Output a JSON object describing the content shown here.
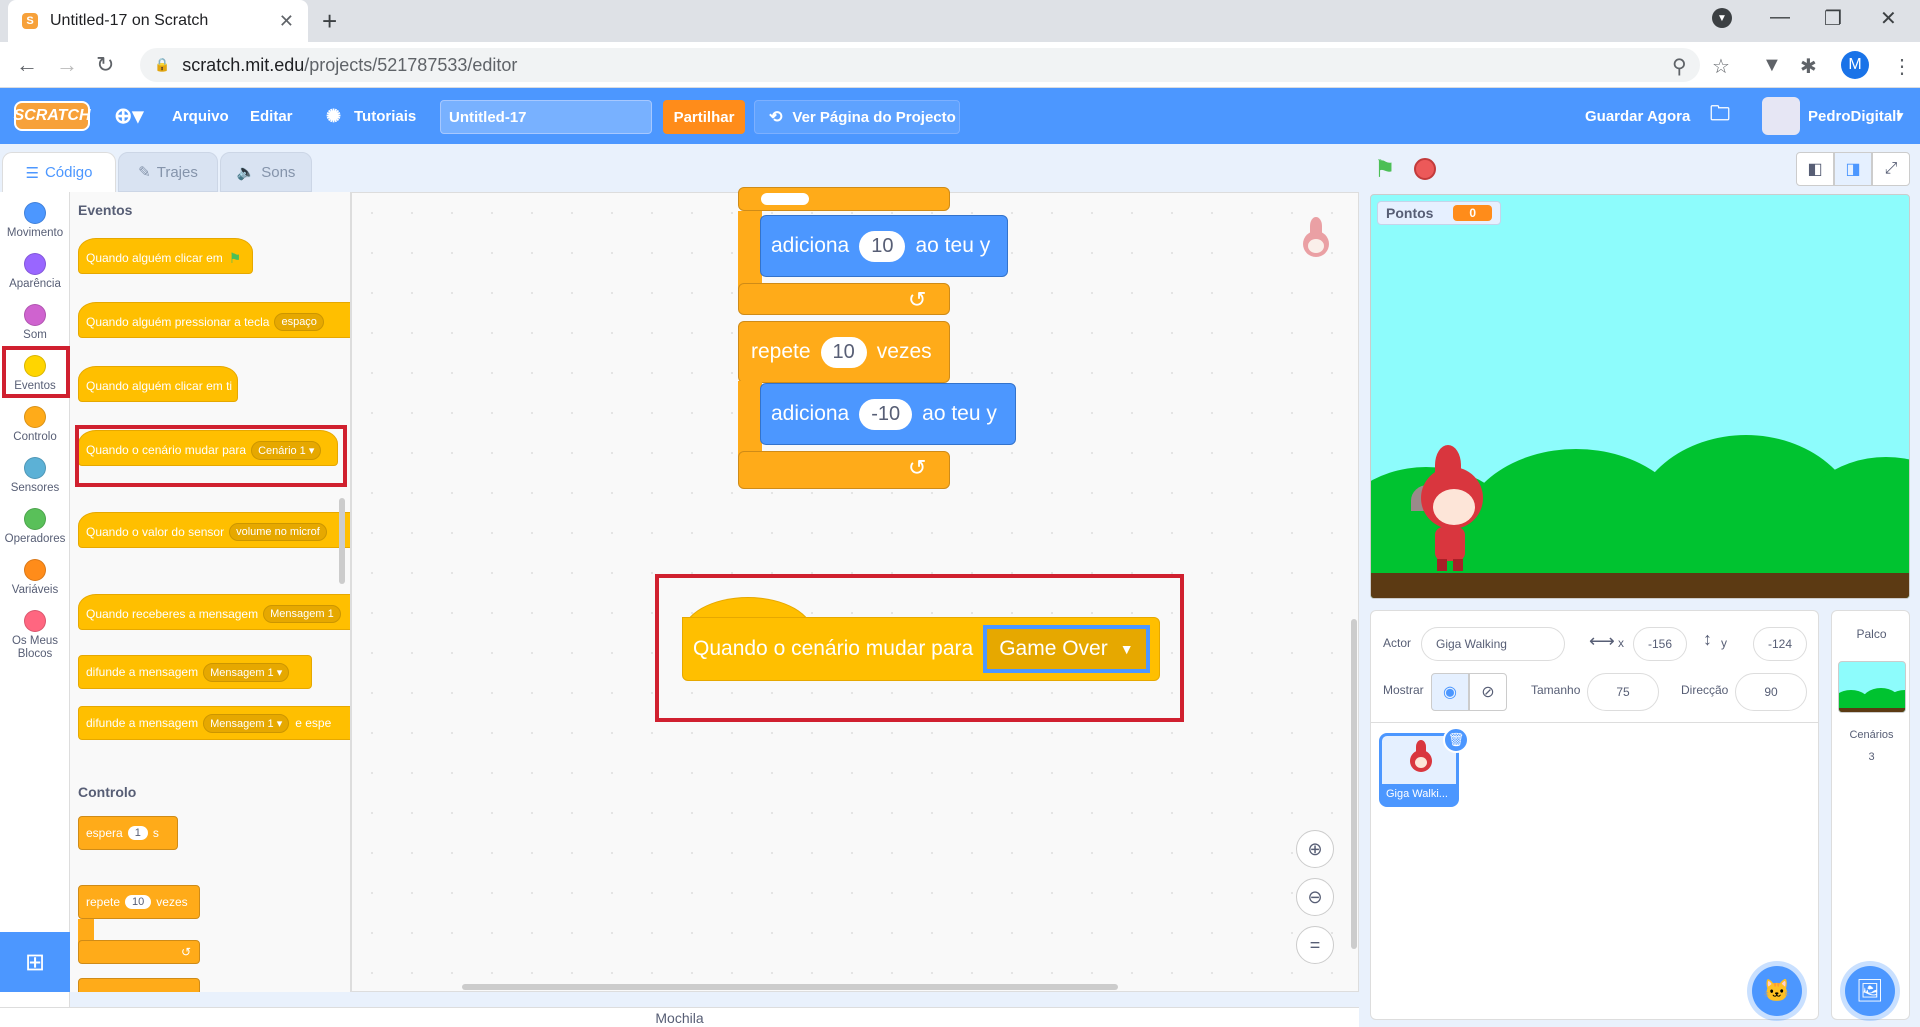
{
  "browser": {
    "tab_title": "Untitled-17 on Scratch",
    "url_host": "scratch.mit.edu",
    "url_path": "/projects/521787533/editor",
    "profile_initial": "M"
  },
  "menubar": {
    "logo": "SCRATCH",
    "file": "Arquivo",
    "edit": "Editar",
    "tutorials": "Tutoriais",
    "project_title": "Untitled-17",
    "share": "Partilhar",
    "see_project": "Ver Página do Projecto",
    "save_now": "Guardar Agora",
    "username": "PedroDigitall"
  },
  "editor_tabs": {
    "code": "Código",
    "costumes": "Trajes",
    "sounds": "Sons"
  },
  "categories": [
    {
      "label": "Movimento",
      "color": "#4c97ff"
    },
    {
      "label": "Aparência",
      "color": "#9966ff"
    },
    {
      "label": "Som",
      "color": "#cf63cf"
    },
    {
      "label": "Eventos",
      "color": "#ffd500"
    },
    {
      "label": "Controlo",
      "color": "#ffab19"
    },
    {
      "label": "Sensores",
      "color": "#5cb1d6"
    },
    {
      "label": "Operadores",
      "color": "#59c059"
    },
    {
      "label": "Variáveis",
      "color": "#ff8c1a"
    },
    {
      "label": "Os Meus Blocos",
      "color": "#ff6680"
    }
  ],
  "palette": {
    "events_heading": "Eventos",
    "flag_clicked": "Quando alguém clicar em",
    "key_pressed": "Quando alguém pressionar a tecla",
    "key_value": "espaço",
    "sprite_clicked": "Quando alguém clicar em ti",
    "backdrop_switch": "Quando o cenário mudar para",
    "backdrop_value": "Cenário 1",
    "sensor_gt": "Quando o valor do sensor",
    "sensor_value": "volume no microf",
    "receive": "Quando receberes a mensagem",
    "receive_value": "Mensagem 1",
    "broadcast": "difunde a mensagem",
    "broadcast_value": "Mensagem 1",
    "broadcast_wait": "difunde a mensagem",
    "broadcast_wait_value": "Mensagem 1",
    "broadcast_wait_suffix": "e espe",
    "control_heading": "Controlo",
    "wait": "espera",
    "wait_value": "1",
    "wait_unit": "s",
    "repeat": "repete",
    "repeat_value": "10",
    "repeat_unit": "vezes"
  },
  "workspace": {
    "change_y_1": "adiciona",
    "change_y_1_value": "10",
    "change_y_1_suffix": "ao teu y",
    "repeat": "repete",
    "repeat_value": "10",
    "repeat_suffix": "vezes",
    "change_y_2": "adiciona",
    "change_y_2_value": "-10",
    "change_y_2_suffix": "ao teu y",
    "hat_label": "Quando o cenário mudar para",
    "hat_value": "Game Over"
  },
  "stage": {
    "score_label": "Pontos",
    "score_value": "0"
  },
  "sprite_info": {
    "actor_label": "Actor",
    "actor_name": "Giga Walking",
    "x_label": "x",
    "x_value": "-156",
    "y_label": "y",
    "y_value": "-124",
    "show_label": "Mostrar",
    "size_label": "Tamanho",
    "size_value": "75",
    "direction_label": "Direcção",
    "direction_value": "90",
    "thumb_label": "Giga Walki..."
  },
  "stage_panel": {
    "title": "Palco",
    "backdrops_label": "Cenários",
    "backdrops_count": "3"
  },
  "mochila": "Mochila"
}
